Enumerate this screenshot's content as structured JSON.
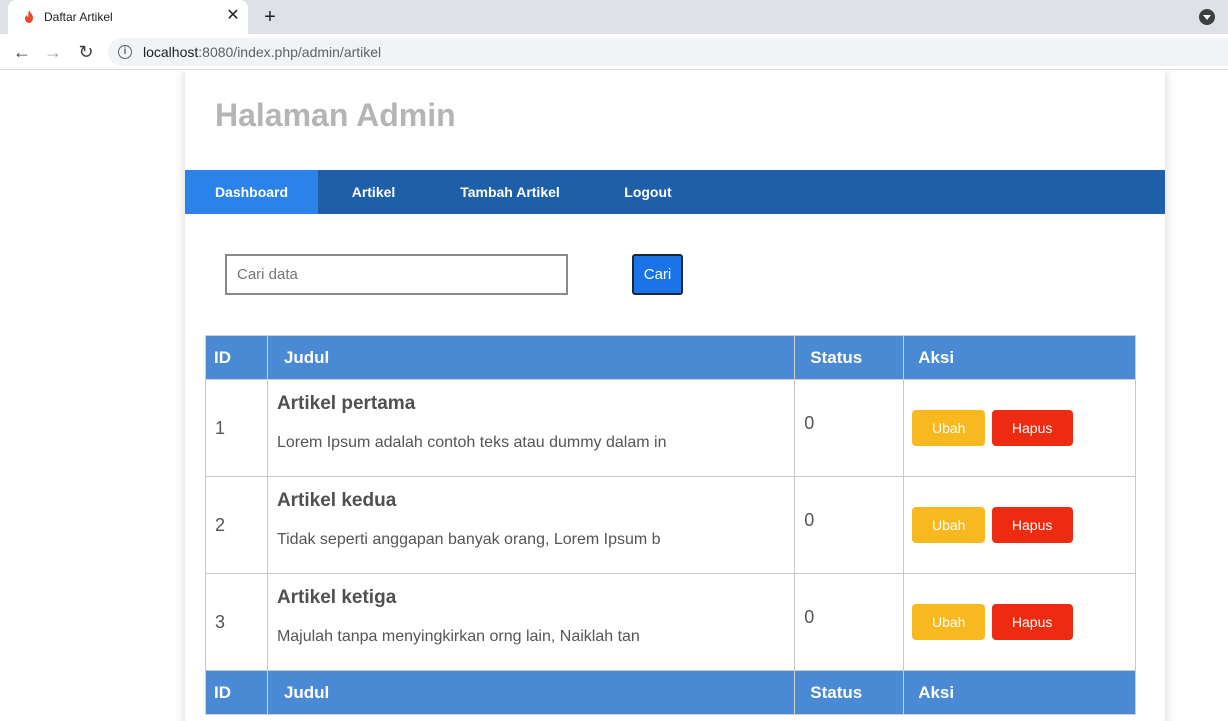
{
  "browser": {
    "tab_title": "Daftar Artikel",
    "url_host": "localhost",
    "url_rest": ":8080/index.php/admin/artikel"
  },
  "page": {
    "site_title": "Halaman Admin",
    "nav": [
      "Dashboard",
      "Artikel",
      "Tambah Artikel",
      "Logout"
    ],
    "search": {
      "placeholder": "Cari data",
      "button": "Cari"
    },
    "table": {
      "headers": [
        "ID",
        "Judul",
        "Status",
        "Aksi"
      ],
      "rows": [
        {
          "id": "1",
          "title": "Artikel pertama",
          "excerpt": "Lorem Ipsum adalah contoh teks atau dummy dalam in",
          "status": "0"
        },
        {
          "id": "2",
          "title": "Artikel kedua",
          "excerpt": "Tidak seperti anggapan banyak orang, Lorem Ipsum b",
          "status": "0"
        },
        {
          "id": "3",
          "title": "Artikel ketiga",
          "excerpt": "Majulah tanpa menyingkirkan orng lain, Naiklah tan",
          "status": "0"
        }
      ],
      "edit_label": "Ubah",
      "delete_label": "Hapus"
    }
  },
  "colors": {
    "navbar": "#1f5faa",
    "nav_active": "#2b83ea",
    "table_header": "#4a89d4",
    "edit": "#f8b820",
    "delete": "#ec2b10"
  }
}
